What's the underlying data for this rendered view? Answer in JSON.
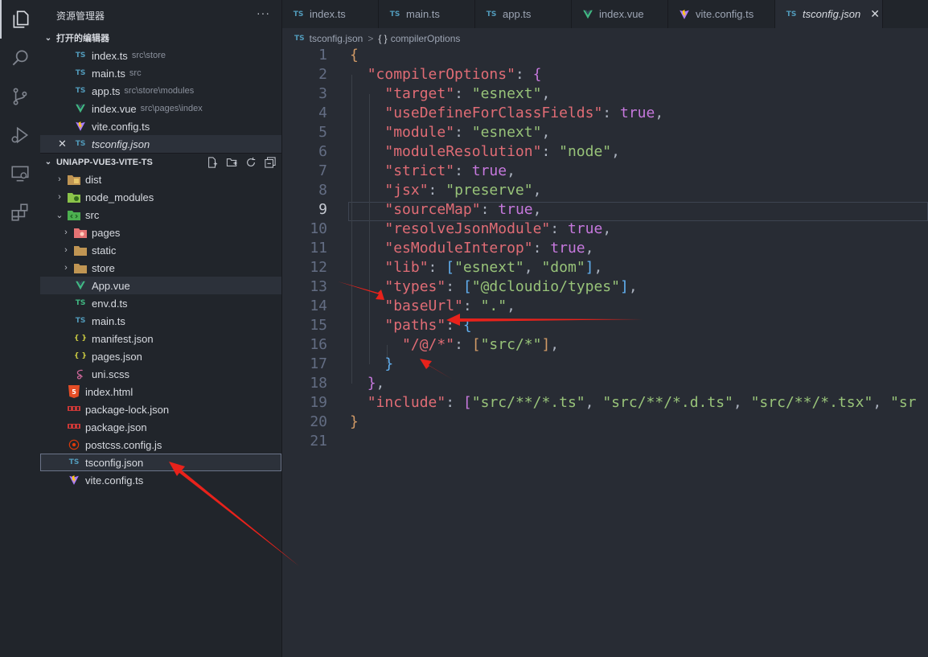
{
  "sidebar": {
    "title": "资源管理器",
    "more": "···",
    "open_editors": {
      "header": "打开的编辑器",
      "items": [
        {
          "name": "index.ts",
          "desc": "src\\store",
          "type": "ts"
        },
        {
          "name": "main.ts",
          "desc": "src",
          "type": "ts"
        },
        {
          "name": "app.ts",
          "desc": "src\\store\\modules",
          "type": "ts"
        },
        {
          "name": "index.vue",
          "desc": "src\\pages\\index",
          "type": "vue"
        },
        {
          "name": "vite.config.ts",
          "desc": "",
          "type": "vite"
        },
        {
          "name": "tsconfig.json",
          "desc": "",
          "type": "tsconfig",
          "close": "✕"
        }
      ]
    },
    "project": {
      "header": "UNIAPP-VUE3-VITE-TS",
      "tree": [
        {
          "name": "dist"
        },
        {
          "name": "node_modules"
        },
        {
          "name": "src"
        },
        {
          "name": "pages"
        },
        {
          "name": "static"
        },
        {
          "name": "store"
        },
        {
          "name": "App.vue"
        },
        {
          "name": "env.d.ts"
        },
        {
          "name": "main.ts"
        },
        {
          "name": "manifest.json"
        },
        {
          "name": "pages.json"
        },
        {
          "name": "uni.scss"
        },
        {
          "name": "index.html"
        },
        {
          "name": "package-lock.json"
        },
        {
          "name": "package.json"
        },
        {
          "name": "postcss.config.js"
        },
        {
          "name": "tsconfig.json"
        },
        {
          "name": "vite.config.ts"
        }
      ]
    }
  },
  "tabs": [
    {
      "label": "index.ts",
      "icon": "TS"
    },
    {
      "label": "main.ts",
      "icon": "TS"
    },
    {
      "label": "app.ts",
      "icon": "TS"
    },
    {
      "label": "index.vue",
      "icon": "V"
    },
    {
      "label": "vite.config.ts",
      "icon": "vite"
    },
    {
      "label": "tsconfig.json",
      "icon": "TS",
      "close": "✕"
    }
  ],
  "icons": {
    "ts": "TS",
    "json": "{ }",
    "vue": "V"
  },
  "breadcrumb": {
    "file": "tsconfig.json",
    "sep": ">",
    "symbol_icon": "{ }",
    "symbol": "compilerOptions"
  },
  "editor": {
    "current_line": 9,
    "line_numbers": [
      "1",
      "2",
      "3",
      "4",
      "5",
      "6",
      "7",
      "8",
      "9",
      "10",
      "11",
      "12",
      "13",
      "14",
      "15",
      "16",
      "17",
      "18",
      "19",
      "20",
      "21"
    ]
  },
  "colors": {
    "accent": "#519aba",
    "arrow": "#e8221b",
    "editor_bg": "#282c34",
    "sidebar_bg": "#21252b"
  }
}
